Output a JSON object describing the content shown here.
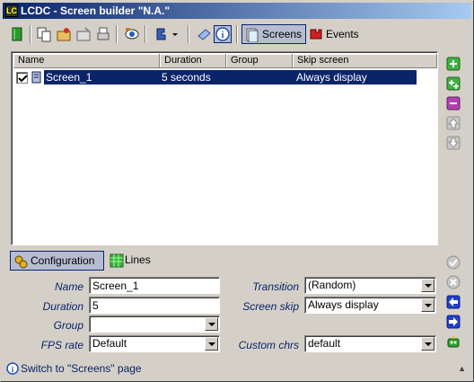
{
  "window": {
    "title": "LCDC - Screen builder \"N.A.\"",
    "app_icon_text": "LC"
  },
  "toolbar": {
    "screens_label": "Screens",
    "events_label": "Events"
  },
  "list": {
    "columns": [
      "Name",
      "Duration",
      "Group",
      "Skip screen"
    ],
    "rows": [
      {
        "checked": true,
        "name": "Screen_1",
        "duration": "5 seconds",
        "group": "",
        "skip": "Always display"
      }
    ]
  },
  "tabs": {
    "configuration": "Configuration",
    "lines": "Lines"
  },
  "form": {
    "name_label": "Name",
    "name_value": "Screen_1",
    "duration_label": "Duration",
    "duration_value": "5",
    "group_label": "Group",
    "group_value": "",
    "fps_label": "FPS rate",
    "fps_value": "Default",
    "transition_label": "Transition",
    "transition_value": "(Random)",
    "screen_skip_label": "Screen skip",
    "screen_skip_value": "Always display",
    "custom_chrs_label": "Custom chrs",
    "custom_chrs_value": "default"
  },
  "status": {
    "text": "Switch to \"Screens\" page"
  },
  "colors": {
    "selection": "#0a246a",
    "face": "#d4d0c8",
    "label": "#0a246a"
  }
}
